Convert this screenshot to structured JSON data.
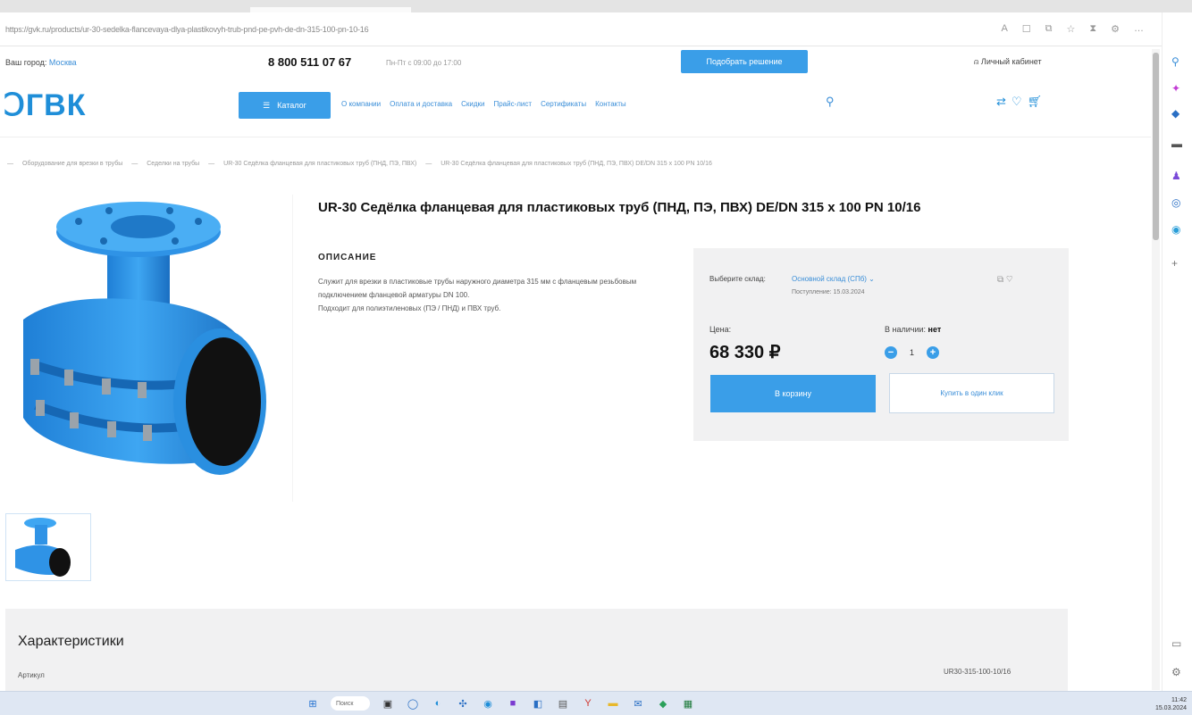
{
  "browser": {
    "url": "https://gvk.ru/products/ur-30-sedelka-flancevaya-dlya-plastikovyh-trub-pnd-pe-pvh-de-dn-315-100-pn-10-16",
    "toolbar_icons": [
      "A",
      "☐",
      "⧉",
      "☆",
      "⧗",
      "⚙",
      "…"
    ]
  },
  "topbar": {
    "city_label": "Ваш город:",
    "city_value": "Москва",
    "phone": "8 800 511 07 67",
    "hours": "Пн-Пт с 09:00 до 17:00",
    "pick_solution_label": "Подобрать решение",
    "account_label": "Личный кабинет"
  },
  "header": {
    "logo_text": "ГВК",
    "catalog_label": "Каталог",
    "nav": [
      "О компании",
      "Оплата и доставка",
      "Скидки",
      "Прайс-лист",
      "Сертификаты",
      "Контакты"
    ]
  },
  "breadcrumb": [
    "Оборудование для врезки в трубы",
    "Седелки на трубы",
    "UR-30 Седёлка фланцевая для пластиковых труб (ПНД, ПЭ, ПВХ)",
    "UR-30 Седёлка фланцевая для пластиковых труб (ПНД, ПЭ, ПВХ) DE/DN 315 x 100 PN 10/16"
  ],
  "product": {
    "title": "UR-30 Седёлка фланцевая для пластиковых труб (ПНД, ПЭ, ПВХ) DE/DN 315 x 100 PN 10/16",
    "description_heading": "ОПИСАНИЕ",
    "description_1": "Служит для врезки в пластиковые трубы наружного диаметра 315 мм с фланцевым резьбовым подключением фланцевой арматуры DN 100.",
    "description_2": "Подходит для полиэтиленовых (ПЭ / ПНД) и ПВХ труб."
  },
  "buybox": {
    "stock_label": "Выберите склад:",
    "stock_value": "Основной склад (СПб) ⌄",
    "stock_date": "Поступление: 15.03.2024",
    "price_label": "Цена:",
    "price": "68 330 ₽",
    "availability_label": "В наличии:",
    "availability_value": "нет",
    "quantity": "1",
    "cart_label": "В корзину",
    "one_click_label": "Купить в один клик"
  },
  "characteristics": {
    "title": "Характеристики",
    "rows": [
      {
        "key": "Артикул",
        "value": "UR30-315-100-10/16"
      }
    ]
  },
  "taskbar": {
    "search_label": "Поиск",
    "time": "11:42",
    "date": "15.03.2024"
  },
  "colors": {
    "accent": "#3a9ee8",
    "logo": "#1f8ed8",
    "panel": "#f1f1f2"
  }
}
